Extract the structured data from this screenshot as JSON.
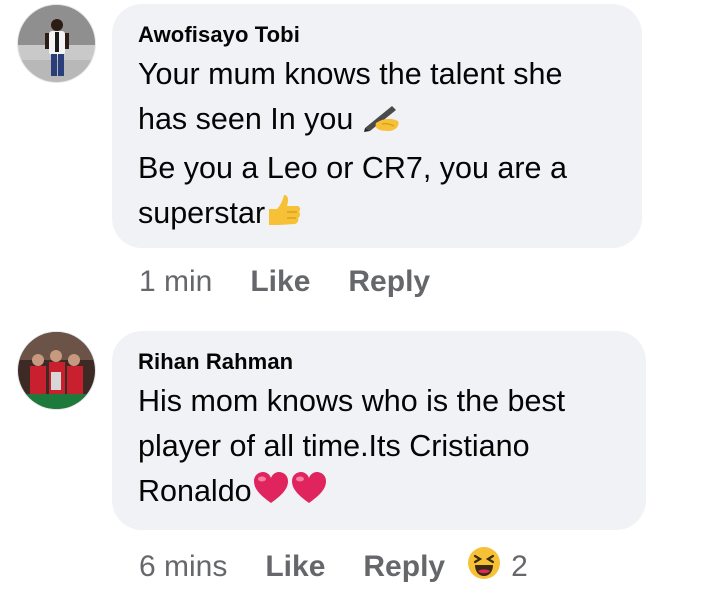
{
  "comments": [
    {
      "author": "Awofisayo Tobi",
      "lines": [
        "Your mum knows the talent she",
        "has seen In you",
        "Be you a Leo or CR7, you are a",
        "superstar"
      ],
      "emojis": [
        "writing-hand-emoji",
        "thumbs-up-emoji"
      ],
      "time": "1 min",
      "like_label": "Like",
      "reply_label": "Reply"
    },
    {
      "author": "Rihan Rahman",
      "lines": [
        "His mom knows who is the best",
        "player of all time.Its Cristiano",
        "Ronaldo"
      ],
      "emojis": [
        "red-heart-emoji",
        "red-heart-emoji"
      ],
      "time": "6 mins",
      "like_label": "Like",
      "reply_label": "Reply",
      "reaction": {
        "icon": "laughing-face-icon",
        "count": "2"
      }
    }
  ],
  "colors": {
    "bubble": "#f0f2f5",
    "text": "#050505",
    "meta": "#65676b",
    "heart": "#e0245e",
    "emoji_yellow": "#f7c137"
  }
}
